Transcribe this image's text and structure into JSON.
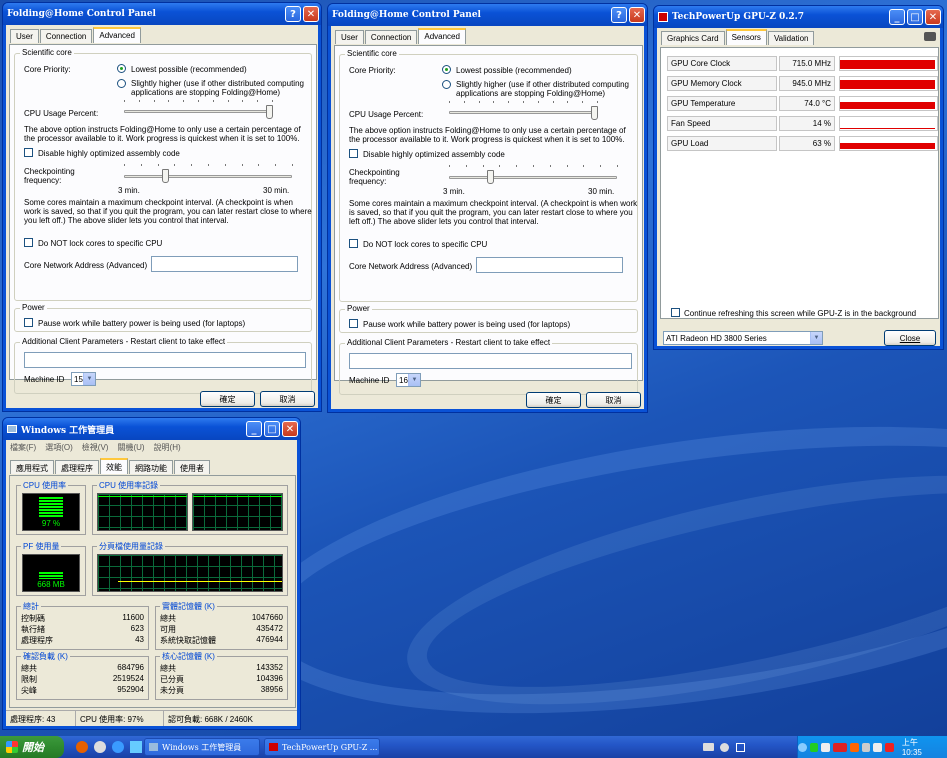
{
  "fah": [
    {
      "title": "Folding@Home Control Panel",
      "tabs": [
        "User",
        "Connection",
        "Advanced"
      ],
      "scientific_core": "Scientific core",
      "core_priority_label": "Core Priority:",
      "radio1": "Lowest possible (recommended)",
      "radio2": "Slightly higher (use if other distributed computing applications are stopping Folding@Home)",
      "cpu_usage_label": "CPU Usage Percent:",
      "cpu_usage_value": 1.0,
      "cpu_note": "The above option instructs Folding@Home to only use a certain percentage of the processor available to it. Work progress is quickest when it is set to 100%.",
      "disable_asm": "Disable highly optimized assembly code",
      "checkpoint_label": "Checkpointing frequency:",
      "checkpoint_value": 0.26,
      "min_label": "3 min.",
      "max_label": "30 min.",
      "checkpoint_note": "Some cores maintain a maximum checkpoint interval. (A checkpoint is when work is saved, so that if you quit the program, you can later restart close to where you left off.) The above slider lets you control that interval.",
      "lock_cores": "Do NOT lock cores to specific CPU",
      "net_addr_label": "Core Network Address (Advanced)",
      "power_legend": "Power",
      "pause_battery": "Pause work while battery power is being used (for laptops)",
      "client_params_legend": "Additional Client Parameters - Restart client to take effect",
      "machine_id_label": "Machine ID",
      "machine_id": "15",
      "ok": "確定",
      "cancel": "取消"
    },
    {
      "title": "Folding@Home Control Panel",
      "tabs": [
        "User",
        "Connection",
        "Advanced"
      ],
      "scientific_core": "Scientific core",
      "core_priority_label": "Core Priority:",
      "radio1": "Lowest possible (recommended)",
      "radio2": "Slightly higher (use if other distributed computing applications are stopping Folding@Home)",
      "cpu_usage_label": "CPU Usage Percent:",
      "cpu_usage_value": 1.0,
      "cpu_note": "The above option instructs Folding@Home to only use a certain percentage of the processor available to it. Work progress is quickest when it is set to 100%.",
      "disable_asm": "Disable highly optimized assembly code",
      "checkpoint_label": "Checkpointing frequency:",
      "checkpoint_value": 0.26,
      "min_label": "3 min.",
      "max_label": "30 min.",
      "checkpoint_note": "Some cores maintain a maximum checkpoint interval. (A checkpoint is when work is saved, so that if you quit the program, you can later restart close to where you left off.) The above slider lets you control that interval.",
      "lock_cores": "Do NOT lock cores to specific CPU",
      "net_addr_label": "Core Network Address (Advanced)",
      "power_legend": "Power",
      "pause_battery": "Pause work while battery power is being used (for laptops)",
      "client_params_legend": "Additional Client Parameters - Restart client to take effect",
      "machine_id_label": "Machine ID",
      "machine_id": "16",
      "ok": "確定",
      "cancel": "取消"
    }
  ],
  "gpuz": {
    "title": "TechPowerUp GPU-Z 0.2.7",
    "tabs": [
      "Graphics Card",
      "Sensors",
      "Validation"
    ],
    "sensors": [
      {
        "name": "GPU Core Clock",
        "value": "715.0 MHz",
        "level": 0.95
      },
      {
        "name": "GPU Memory Clock",
        "value": "945.0 MHz",
        "level": 0.95
      },
      {
        "name": "GPU Temperature",
        "value": "74.0 °C",
        "level": 0.75
      },
      {
        "name": "Fan Speed",
        "value": "14 %",
        "level": 0.14
      },
      {
        "name": "GPU Load",
        "value": "63 %",
        "level": 0.63
      }
    ],
    "refresh_label": "Continue refreshing this screen while GPU-Z is in the background",
    "card": "ATI Radeon HD 3800 Series",
    "close": "Close"
  },
  "taskmgr": {
    "title": "Windows 工作管理員",
    "menu": [
      "檔案(F)",
      "選項(O)",
      "檢視(V)",
      "關機(U)",
      "說明(H)"
    ],
    "tabs": [
      "應用程式",
      "處理程序",
      "效能",
      "網路功能",
      "使用者"
    ],
    "cpu_usage_legend": "CPU 使用率",
    "cpu_usage_value": "97 %",
    "cpu_level": 0.97,
    "cpu_history_legend": "CPU 使用率記錄",
    "pf_usage_legend": "PF 使用量",
    "pf_usage_value": "668 MB",
    "pf_level": 0.33,
    "pf_history_legend": "分頁檔使用量記錄",
    "totals": {
      "legend": "總計",
      "rows": [
        [
          "控制碼",
          "11600"
        ],
        [
          "執行緒",
          "623"
        ],
        [
          "處理程序",
          "43"
        ]
      ]
    },
    "physical": {
      "legend": "實體記憶體 (K)",
      "rows": [
        [
          "總共",
          "1047660"
        ],
        [
          "可用",
          "435472"
        ],
        [
          "系統快取記憶體",
          "476944"
        ]
      ]
    },
    "commit": {
      "legend": "確認負載 (K)",
      "rows": [
        [
          "總共",
          "684796"
        ],
        [
          "限制",
          "2519524"
        ],
        [
          "尖峰",
          "952904"
        ]
      ]
    },
    "kernel": {
      "legend": "核心記憶體 (K)",
      "rows": [
        [
          "總共",
          "143352"
        ],
        [
          "已分頁",
          "104396"
        ],
        [
          "未分頁",
          "38956"
        ]
      ]
    },
    "status": [
      "處理程序: 43",
      "CPU 使用率: 97%",
      "認可負載: 668K / 2460K"
    ]
  },
  "taskbar": {
    "start": "開始",
    "buttons": [
      "Windows 工作管理員",
      "TechPowerUp GPU-Z ..."
    ],
    "clock": "上午 10:35"
  }
}
